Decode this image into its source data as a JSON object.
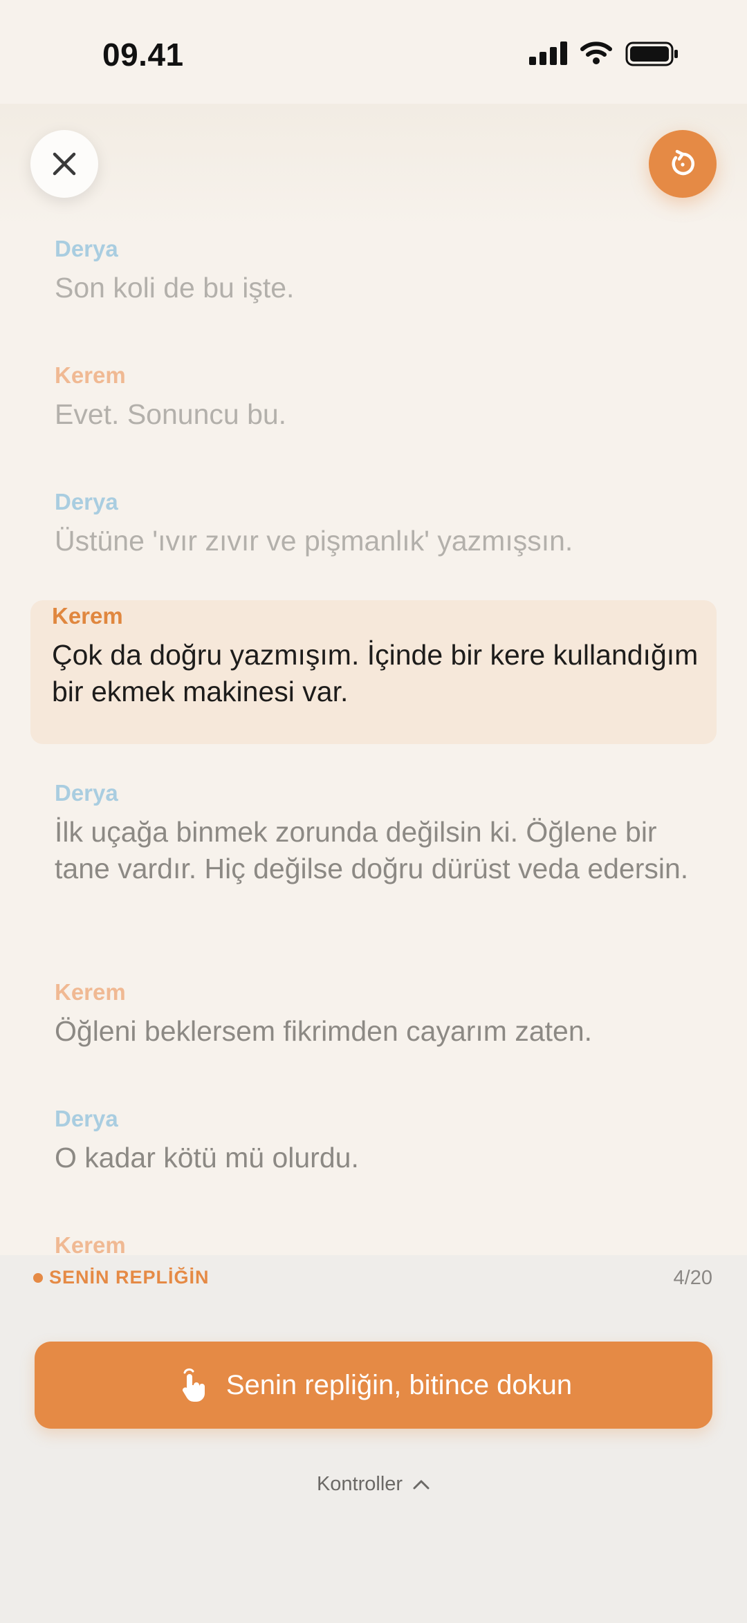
{
  "status_bar": {
    "time": "09.41",
    "icons": [
      "cellular-signal-icon",
      "wifi-icon",
      "battery-icon"
    ]
  },
  "header": {
    "close_icon": "close-icon",
    "restart_icon": "restart-icon"
  },
  "script": {
    "lines": [
      {
        "speaker": "Derya",
        "text": "Son koli de bu işte.",
        "state": "past"
      },
      {
        "speaker": "Kerem",
        "text": "Evet. Sonuncu bu.",
        "state": "past"
      },
      {
        "speaker": "Derya",
        "text": "Üstüne 'ıvır zıvır ve pişmanlık' yazmışsın.",
        "state": "past"
      },
      {
        "speaker": "Kerem",
        "text": "Çok da doğru yazmışım. İçinde bir kere kullandığım bir ekmek makinesi var.",
        "state": "active"
      },
      {
        "speaker": "Derya",
        "text": "İlk uçağa binmek zorunda değilsin ki. Öğlene bir tane vardır. Hiç değilse doğru dürüst veda edersin.",
        "state": "upcoming"
      },
      {
        "speaker": "Kerem",
        "text": "Öğleni beklersem fikrimden cayarım zaten.",
        "state": "upcoming"
      },
      {
        "speaker": "Derya",
        "text": "O kadar kötü mü olurdu.",
        "state": "upcoming"
      },
      {
        "speaker": "Kerem",
        "text": "",
        "state": "upcoming"
      }
    ]
  },
  "panel": {
    "your_line_label": "SENİN REPLİĞİN",
    "progress": "4/20",
    "done_button_label": "Senin repliğin, bitince dokun",
    "done_button_icon": "tap-hand-icon",
    "controls_label": "Kontroller",
    "controls_icon": "chevron-up-icon"
  },
  "colors": {
    "accent": "#e58a45",
    "derya": "#a9cde0",
    "kerem": "#f0b993",
    "background": "#f7f2ec"
  }
}
